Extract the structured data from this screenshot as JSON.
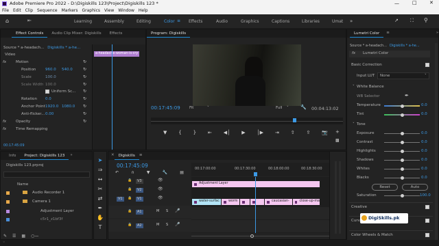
{
  "app": {
    "title": "Adobe Premiere Pro 2022 - D:\\Digiskills 123\\Project\\Digiskills 123 *",
    "menus": [
      "File",
      "Edit",
      "Clip",
      "Sequence",
      "Markers",
      "Graphics",
      "View",
      "Window",
      "Help"
    ],
    "workspaces": [
      "Learning",
      "Assembly",
      "Editing",
      "Color",
      "Effects",
      "Audio",
      "Graphics",
      "Captions",
      "Libraries",
      "Umat"
    ],
    "active_workspace": "Color"
  },
  "effect_controls": {
    "tabs": [
      "Effect Controls",
      "Audio Clip Mixer: Digiskills",
      "Effects"
    ],
    "source": "Source * a-headach...",
    "seq": "Digiskills * a-he...",
    "clip_label": "a-headache-woman-is-cry",
    "section_video": "Video",
    "motion": "Motion",
    "position": {
      "label": "Position",
      "x": "960.0",
      "y": "540.0"
    },
    "scale": {
      "label": "Scale",
      "value": "100.0"
    },
    "scale_width": {
      "label": "Scale Width",
      "value": "100.0"
    },
    "uniform": "Uniform Sc...",
    "rotation": {
      "label": "Rotation",
      "value": "0.0"
    },
    "anchor": {
      "label": "Anchor Point",
      "x": "1920.0",
      "y": "1080.0"
    },
    "antiflicker": {
      "label": "Anti-flicker...",
      "value": "0.00"
    },
    "opacity": "Opacity",
    "time_remap": "Time Remapping",
    "timecode": "00:17:45:09"
  },
  "program": {
    "title": "Program: Digiskills",
    "timecode": "00:17:45:09",
    "fit": "Fit",
    "quality": "Full",
    "duration": "00:04:13:02"
  },
  "project": {
    "tabs": [
      "Info",
      "Project: Digiskills 123"
    ],
    "file": "Digiskills 123.prproj",
    "col_name": "Name",
    "items": [
      "Audio Recorder 1",
      "Camera 1",
      "Adjustment Layer",
      "c5r1_z1bf3f"
    ]
  },
  "timeline": {
    "tab": "Digiskills",
    "timecode": "00:17:45:09",
    "ruler": [
      "00:17:00:00",
      "00:17:30:00",
      "00:18:00:00",
      "00:18:30:00"
    ],
    "tracks_video": [
      "V3",
      "V2",
      "V1"
    ],
    "tracks_audio": [
      "A1",
      "A2"
    ],
    "source_patch": "V1",
    "adjustment_clip": "Adjustment Layer",
    "clips": [
      "water-surfac",
      "worm",
      "caucasian-",
      "close-up-ma"
    ]
  },
  "lumetri": {
    "tab": "Lumetri Color",
    "source": "Source * a-headach...",
    "seq": "Digiskills * a-he...",
    "header": "Lumetri Color",
    "basic": "Basic Correction",
    "input_lut_label": "Input LUT",
    "input_lut": "None",
    "white_balance": "White Balance",
    "wb_selector": "WB Selector",
    "temperature": {
      "label": "Temperature",
      "value": "0.0",
      "level": 0.5
    },
    "tint": {
      "label": "Tint",
      "value": "0.0",
      "level": 0.5
    },
    "tone": "Tone",
    "exposure": {
      "label": "Exposure",
      "value": "0.0",
      "level": 0.5
    },
    "contrast": {
      "label": "Contrast",
      "value": "0.0",
      "level": 0.5
    },
    "highlights": {
      "label": "Highlights",
      "value": "0.0",
      "level": 0.5
    },
    "shadows": {
      "label": "Shadows",
      "value": "0.0",
      "level": 0.5
    },
    "whites": {
      "label": "Whites",
      "value": "0.0",
      "level": 0.5
    },
    "blacks": {
      "label": "Blacks",
      "value": "0.0",
      "level": 0.5
    },
    "reset": "Reset",
    "auto": "Auto",
    "saturation": {
      "label": "Saturation",
      "value": "100.0",
      "level": 0.5
    },
    "creative": "Creative",
    "curves": "Curves",
    "wheels": "Color Wheels & Match"
  },
  "watermark": "DigiSkills.pk",
  "colors": {
    "accent": "#3c9ae6",
    "adjustment": "#f3bff3",
    "clip": "#b3e4f6",
    "timeline_clip_purple": "#f5c7f0"
  }
}
